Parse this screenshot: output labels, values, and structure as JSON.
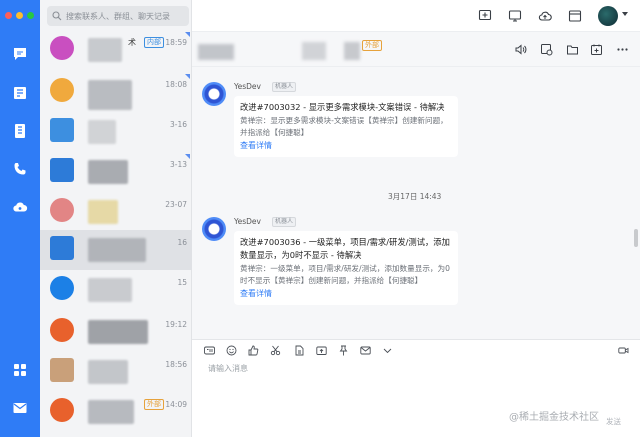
{
  "window": {
    "traffic_colors": [
      "#fe5f57",
      "#febc2e",
      "#28c840"
    ]
  },
  "search": {
    "placeholder": "搜索联系人、群组、聊天记录"
  },
  "conversations": [
    {
      "title": "术",
      "tag": "内部",
      "time": "18:59",
      "preview": "",
      "avatar_color": "#c94fc0"
    },
    {
      "title": "",
      "tag": "",
      "time": "18:08",
      "preview": "",
      "avatar_color": "#f0a93d"
    },
    {
      "title": "",
      "tag": "",
      "time": "3-16",
      "preview": "",
      "avatar_color": "#3d8fe0"
    },
    {
      "title": "",
      "tag": "",
      "time": "3-13",
      "preview": "",
      "avatar_color": "#2d7bd8"
    },
    {
      "title": "",
      "tag": "",
      "time": "23-07",
      "preview": "",
      "avatar_color": "#e28585"
    },
    {
      "title": "",
      "tag": "",
      "time": "16",
      "preview": "",
      "avatar_color": "#2d7bd8"
    },
    {
      "title": "",
      "tag": "",
      "time": "15",
      "preview": "",
      "avatar_color": "#1c80e6"
    },
    {
      "title": "",
      "tag": "",
      "time": "19:12",
      "preview": "",
      "avatar_color": "#e8612c"
    },
    {
      "title": "",
      "tag": "",
      "time": "18:56",
      "preview": "",
      "avatar_color": "#c9a07a"
    },
    {
      "title": "",
      "tag": "外部",
      "time": "14:09",
      "preview": "",
      "avatar_color": "#e8612c"
    }
  ],
  "chat_header": {
    "tag": "外部"
  },
  "messages": [
    {
      "sender": "YesDev",
      "bot_label": "机器人",
      "title": "改进#7003032 - 显示更多需求模块-文案错误 - 待解决",
      "detail": "黄禅宗：显示更多需求模块-文案错误【黄禅宗】创建新问题，并指派给【何捷聪】",
      "link": "查看详情"
    },
    {
      "sender": "YesDev",
      "bot_label": "机器人",
      "title": "改进#7003036 - 一级菜单，项目/需求/研发/测试，添加数量显示，为0时不显示 - 待解决",
      "detail": "黄禅宗：一级菜单，项目/需求/研发/测试，添加数量显示，为0时不显示【黄禅宗】创建新问题，并指派给【何捷聪】",
      "link": "查看详情"
    }
  ],
  "timestamp": "3月17日 14:43",
  "input": {
    "placeholder": "请输入消息",
    "send_label": "发送"
  },
  "watermark": "@稀土掘金技术社区",
  "colors": {
    "rail": "#2f7cf6",
    "link": "#2f7cf6",
    "internal_tag": "#3d8fe0",
    "external_tag": "#e6a23c"
  }
}
